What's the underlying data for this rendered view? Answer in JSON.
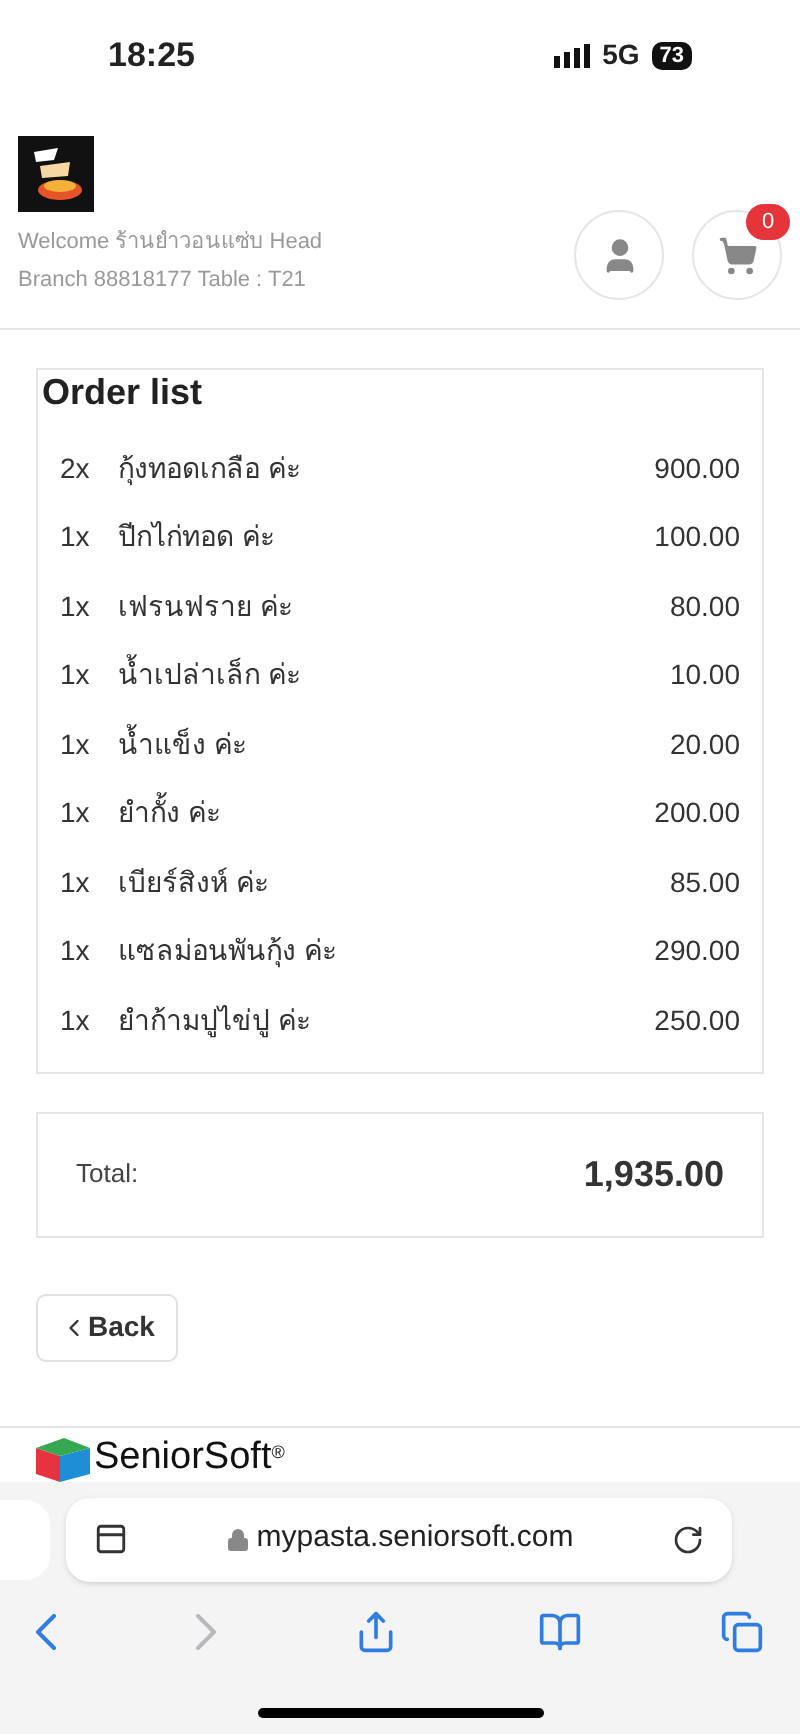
{
  "status_bar": {
    "time": "18:25",
    "network": "5G",
    "battery": "73"
  },
  "header": {
    "welcome": "Welcome ร้านยำวอนแซ่บ Head Branch 88818177 Table : T21",
    "cart_count": "0"
  },
  "order": {
    "title": "Order list",
    "items": [
      {
        "qty": "2x",
        "name": "กุ้งทอดเกลือ ค่ะ",
        "price": "900.00"
      },
      {
        "qty": "1x",
        "name": "ปีกไก่ทอด ค่ะ",
        "price": "100.00"
      },
      {
        "qty": "1x",
        "name": "เฟรนฟราย ค่ะ",
        "price": "80.00"
      },
      {
        "qty": "1x",
        "name": "น้ำเปล่าเล็ก ค่ะ",
        "price": "10.00"
      },
      {
        "qty": "1x",
        "name": "น้ำแข็ง ค่ะ",
        "price": "20.00"
      },
      {
        "qty": "1x",
        "name": "ยำกั้ง ค่ะ",
        "price": "200.00"
      },
      {
        "qty": "1x",
        "name": "เบียร์สิงห์ ค่ะ",
        "price": "85.00"
      },
      {
        "qty": "1x",
        "name": "แซลม่อนพันกุ้ง ค่ะ",
        "price": "290.00"
      },
      {
        "qty": "1x",
        "name": "ยำก้ามปูไข่ปู ค่ะ",
        "price": "250.00"
      }
    ]
  },
  "total": {
    "label": "Total:",
    "value": "1,935.00"
  },
  "back_button": "Back",
  "footer": {
    "brand": "SeniorSoft",
    "mark": "®"
  },
  "browser": {
    "url": "mypasta.seniorsoft.com",
    "back_disabled": false,
    "forward_disabled": true
  }
}
